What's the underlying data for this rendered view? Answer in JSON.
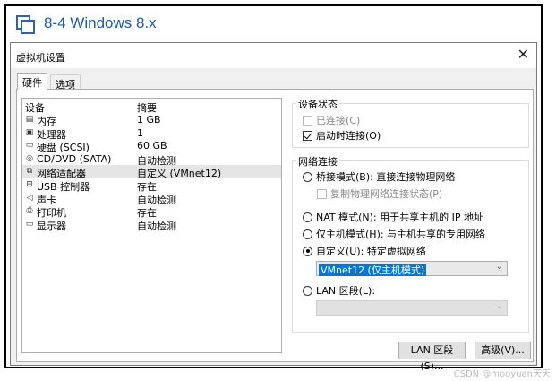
{
  "window": {
    "title": "8-4 Windows 8.x",
    "icon": "vm-window-icon"
  },
  "dialog": {
    "title": "虚拟机设置",
    "tabs": [
      {
        "label": "硬件"
      },
      {
        "label": "选项"
      }
    ]
  },
  "device_list": {
    "headers": {
      "device": "设备",
      "summary": "摘要"
    },
    "rows": [
      {
        "icon": "memory-icon",
        "name": "内存",
        "summary": "1 GB"
      },
      {
        "icon": "cpu-icon",
        "name": "处理器",
        "summary": "1"
      },
      {
        "icon": "hard-disk-icon",
        "name": "硬盘 (SCSI)",
        "summary": "60 GB"
      },
      {
        "icon": "cd-dvd-icon",
        "name": "CD/DVD (SATA)",
        "summary": "自动检测"
      },
      {
        "icon": "network-adapter-icon",
        "name": "网络适配器",
        "summary": "自定义 (VMnet12)",
        "selected": true
      },
      {
        "icon": "usb-icon",
        "name": "USB 控制器",
        "summary": "存在"
      },
      {
        "icon": "sound-icon",
        "name": "声卡",
        "summary": "自动检测"
      },
      {
        "icon": "printer-icon",
        "name": "打印机",
        "summary": "存在"
      },
      {
        "icon": "display-icon",
        "name": "显示器",
        "summary": "自动检测"
      }
    ]
  },
  "device_status": {
    "label": "设备状态",
    "connected": {
      "label": "已连接(C)",
      "checked": false,
      "enabled": false
    },
    "connect_on_start": {
      "label": "启动时连接(O)",
      "checked": true
    }
  },
  "network_connection": {
    "label": "网络连接",
    "bridged": {
      "label": "桥接模式(B): 直接连接物理网络",
      "selected": false
    },
    "replicate": {
      "label": "复制物理网络连接状态(P)",
      "checked": false,
      "enabled": false
    },
    "nat": {
      "label": "NAT 模式(N): 用于共享主机的 IP 地址",
      "selected": false
    },
    "host_only": {
      "label": "仅主机模式(H): 与主机共享的专用网络",
      "selected": false
    },
    "custom": {
      "label": "自定义(U): 特定虚拟网络",
      "selected": true
    },
    "custom_select": {
      "value": "VMnet12 (仅主机模式)"
    },
    "lan_segment": {
      "label": "LAN 区段(L):",
      "selected": false
    },
    "lan_select": {
      "value": ""
    }
  },
  "buttons": {
    "lan_segments": "LAN 区段(S)...",
    "advanced": "高级(V)..."
  },
  "watermark": "CSDN @mooyuan天天",
  "colors": {
    "title_blue": "#1e5aa8",
    "selected_row": "#e5e5e5",
    "highlight": "#0078d7"
  }
}
